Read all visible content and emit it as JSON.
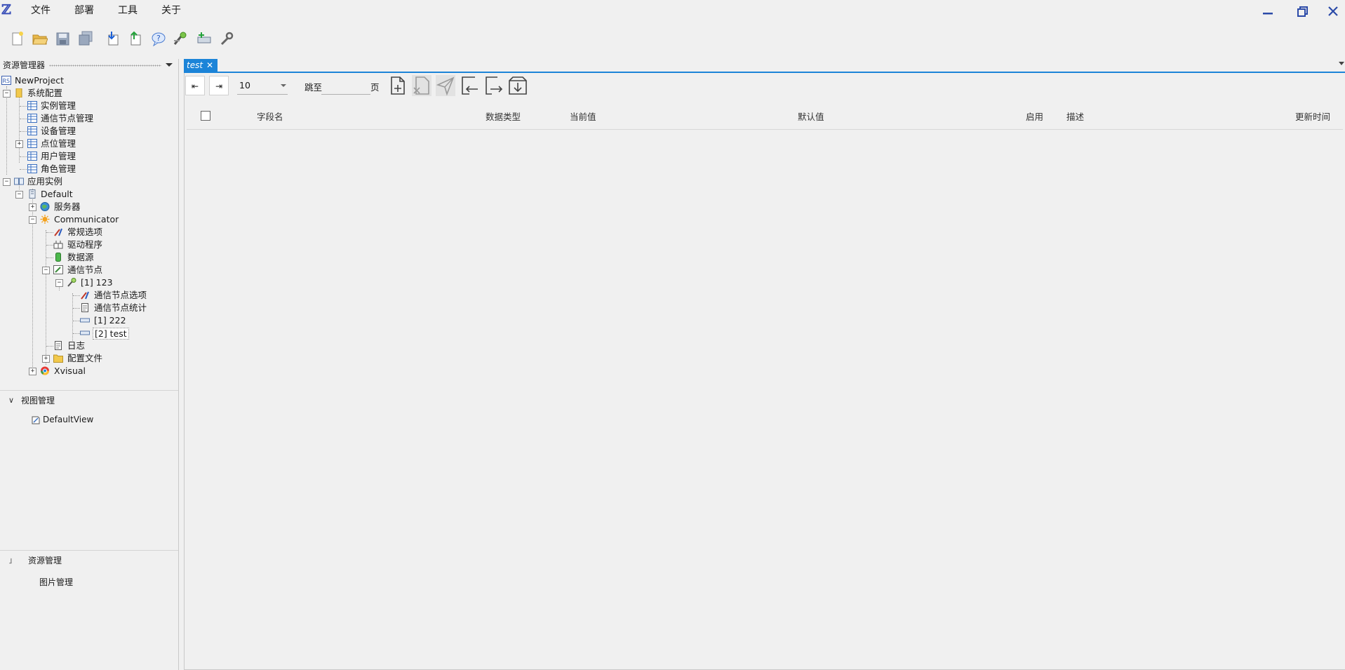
{
  "menu": {
    "file": "文件",
    "deploy": "部署",
    "tools": "工具",
    "about": "关于"
  },
  "toolbar": {
    "icons": [
      "new-file-icon",
      "open-folder-icon",
      "save-icon",
      "save-all-icon",
      "import-icon",
      "export-icon",
      "help-icon",
      "connect-icon",
      "add-device-icon",
      "wrench-icon"
    ]
  },
  "explorer": {
    "title": "资源管理器",
    "tree": {
      "project": "NewProject",
      "system_config": "系统配置",
      "instance_mgmt": "实例管理",
      "comm_node_mgmt": "通信节点管理",
      "device_mgmt": "设备管理",
      "point_mgmt": "点位管理",
      "user_mgmt": "用户管理",
      "role_mgmt": "角色管理",
      "app_instance": "应用实例",
      "default": "Default",
      "server": "服务器",
      "communicator": "Communicator",
      "general_options": "常规选项",
      "driver": "驱动程序",
      "data_source": "数据源",
      "comm_nodes": "通信节点",
      "node_123": "[1] 123",
      "node_options": "通信节点选项",
      "node_stats": "通信节点统计",
      "item_222": "[1] 222",
      "item_test": "[2] test",
      "log": "日志",
      "config_files": "配置文件",
      "xvisual": "Xvisual"
    }
  },
  "view_mgmt": {
    "title": "视图管理",
    "default_view": "DefaultView"
  },
  "resource_mgmt": {
    "title": "资源管理",
    "image_mgmt": "图片管理"
  },
  "tab": {
    "label": "test",
    "close": "✕"
  },
  "pager": {
    "first": "⇤",
    "prev": "⇥",
    "page_size": "10",
    "jump_label": "跳至",
    "page_suffix": "页"
  },
  "table": {
    "columns": [
      "字段名",
      "数据类型",
      "当前值",
      "默认值",
      "启用",
      "描述",
      "更新时间"
    ],
    "rows": []
  },
  "colors": {
    "accent": "#1c84d8",
    "window_button": "#2b4aa8"
  }
}
